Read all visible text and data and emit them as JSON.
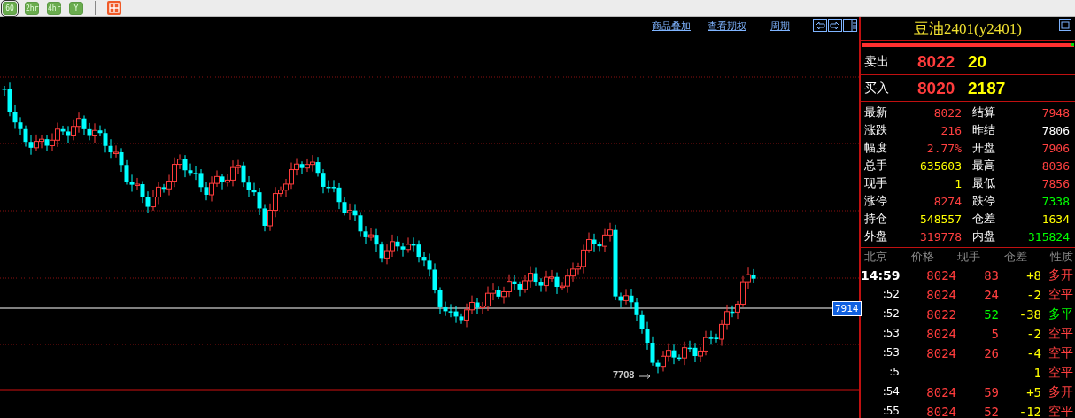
{
  "toolbar": {
    "buttons": [
      {
        "label": "60",
        "selected": true
      },
      {
        "label": "2hr",
        "selected": false
      },
      {
        "label": "4hr",
        "selected": false
      },
      {
        "label": "Y",
        "selected": false
      }
    ]
  },
  "chart_header": {
    "links": [
      "商品叠加",
      "查看期权",
      "周期"
    ]
  },
  "chart": {
    "price_marker": "7914",
    "low_label": "7708"
  },
  "quote": {
    "title": "豆油2401(y2401)",
    "sell": {
      "label": "卖出",
      "price": "8022",
      "volume": "20"
    },
    "buy": {
      "label": "买入",
      "price": "8020",
      "volume": "2187"
    }
  },
  "stats": [
    {
      "label": "最新",
      "value": "8022",
      "color": "#ff4040"
    },
    {
      "label": "结算",
      "value": "7948",
      "color": "#ff4040"
    },
    {
      "label": "涨跌",
      "value": "216",
      "color": "#ff4040"
    },
    {
      "label": "昨结",
      "value": "7806",
      "color": "#ffffff"
    },
    {
      "label": "幅度",
      "value": "2.77%",
      "color": "#ff4040"
    },
    {
      "label": "开盘",
      "value": "7906",
      "color": "#ff4040"
    },
    {
      "label": "总手",
      "value": "635603",
      "color": "#ffff00"
    },
    {
      "label": "最高",
      "value": "8036",
      "color": "#ff4040"
    },
    {
      "label": "现手",
      "value": "1",
      "color": "#ffff00"
    },
    {
      "label": "最低",
      "value": "7856",
      "color": "#ff4040"
    },
    {
      "label": "涨停",
      "value": "8274",
      "color": "#ff4040"
    },
    {
      "label": "跌停",
      "value": "7338",
      "color": "#00ff00"
    },
    {
      "label": "持仓",
      "value": "548557",
      "color": "#ffff00"
    },
    {
      "label": "仓差",
      "value": "1634",
      "color": "#ffff00"
    },
    {
      "label": "外盘",
      "value": "319778",
      "color": "#ff4040"
    },
    {
      "label": "内盘",
      "value": "315824",
      "color": "#00ff00"
    }
  ],
  "ticks": {
    "columns": [
      "北京",
      "价格",
      "现手",
      "仓差",
      "性质"
    ],
    "rows": [
      {
        "time": "14:59",
        "price": "8024",
        "hand": "83",
        "diff": "+8",
        "nature": "多开",
        "color": "#ff4040"
      },
      {
        "time": ":52",
        "price": "8024",
        "hand": "24",
        "diff": "-2",
        "nature": "空平",
        "color": "#ff4040"
      },
      {
        "time": ":52",
        "price": "8022",
        "hand": "52",
        "diff": "-38",
        "nature": "多平",
        "color": "#00ff00"
      },
      {
        "time": ":53",
        "price": "8024",
        "hand": "5",
        "diff": "-2",
        "nature": "空平",
        "color": "#ff4040"
      },
      {
        "time": ":53",
        "price": "8024",
        "hand": "26",
        "diff": "-4",
        "nature": "空平",
        "color": "#ff4040"
      },
      {
        "time": ":5",
        "diff": "1",
        "nature": "空平",
        "color": "#ff4040"
      },
      {
        "time": ":54",
        "price": "8024",
        "hand": "59",
        "diff": "+5",
        "nature": "多开",
        "color": "#ff4040"
      },
      {
        "time": ":55",
        "price": "8024",
        "hand": "52",
        "diff": "-12",
        "nature": "空平",
        "color": "#ff4040"
      }
    ]
  }
}
